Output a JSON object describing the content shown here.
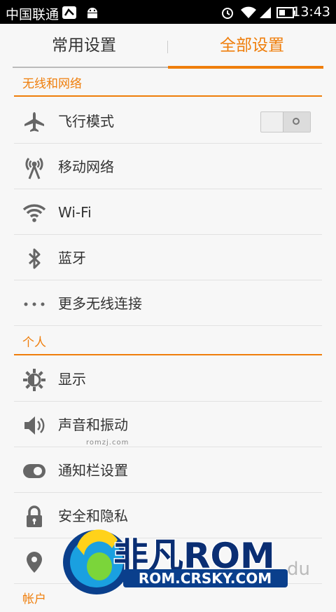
{
  "status_bar": {
    "carrier": "中国联通",
    "time": "13:43"
  },
  "tabs": {
    "left": "常用设置",
    "right": "全部设置"
  },
  "sections": [
    {
      "label": "无线和网络"
    },
    {
      "label": "个人"
    },
    {
      "label": "帐户"
    }
  ],
  "wireless_items": [
    {
      "label": "飞行模式",
      "icon": "airplane-icon",
      "toggle": false
    },
    {
      "label": "移动网络",
      "icon": "antenna-icon"
    },
    {
      "label": "Wi-Fi",
      "icon": "wifi-icon"
    },
    {
      "label": "蓝牙",
      "icon": "bluetooth-icon"
    },
    {
      "label": "更多无线连接",
      "icon": "more-icon"
    }
  ],
  "personal_items": [
    {
      "label": "显示",
      "icon": "brightness-icon"
    },
    {
      "label": "声音和振动",
      "icon": "speaker-icon"
    },
    {
      "label": "通知栏设置",
      "icon": "toggle-icon"
    },
    {
      "label": "安全和隐私",
      "icon": "lock-icon"
    },
    {
      "label": "",
      "icon": "location-icon"
    }
  ],
  "watermark": {
    "small": "romzj.com",
    "brand": "非凡ROM",
    "url": "ROM.CRSKY.COM",
    "suffix": "du"
  },
  "colors": {
    "accent": "#ef7e0b",
    "statusbar": "#000000",
    "background": "#f7f7f7"
  }
}
